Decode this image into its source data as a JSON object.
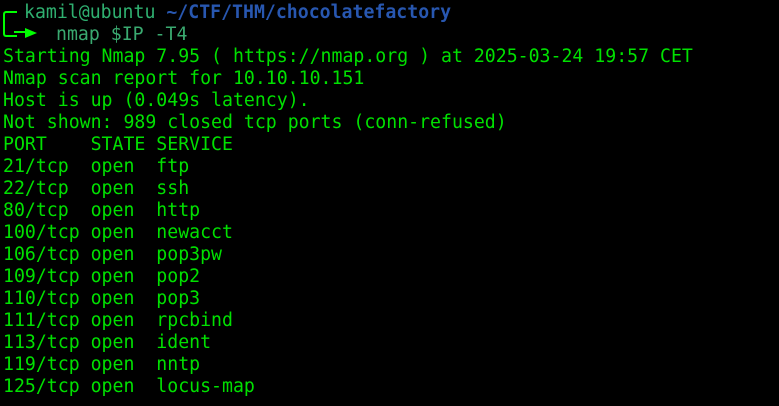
{
  "prompt": {
    "user": "kamil@ubuntu",
    "path": "~/CTF/THM/chocolatefactory",
    "command": "nmap $IP -T4"
  },
  "colors": {
    "output": "#00e000",
    "user": "#2fb070",
    "path": "#2857b0",
    "prompt_box": "#00ff00"
  },
  "output": [
    "Starting Nmap 7.95 ( https://nmap.org ) at 2025-03-24 19:57 CET",
    "Nmap scan report for 10.10.10.151",
    "Host is up (0.049s latency).",
    "Not shown: 989 closed tcp ports (conn-refused)",
    "PORT    STATE SERVICE",
    "21/tcp  open  ftp",
    "22/tcp  open  ssh",
    "80/tcp  open  http",
    "100/tcp open  newacct",
    "106/tcp open  pop3pw",
    "109/tcp open  pop2",
    "110/tcp open  pop3",
    "111/tcp open  rpcbind",
    "113/tcp open  ident",
    "119/tcp open  nntp",
    "125/tcp open  locus-map"
  ]
}
